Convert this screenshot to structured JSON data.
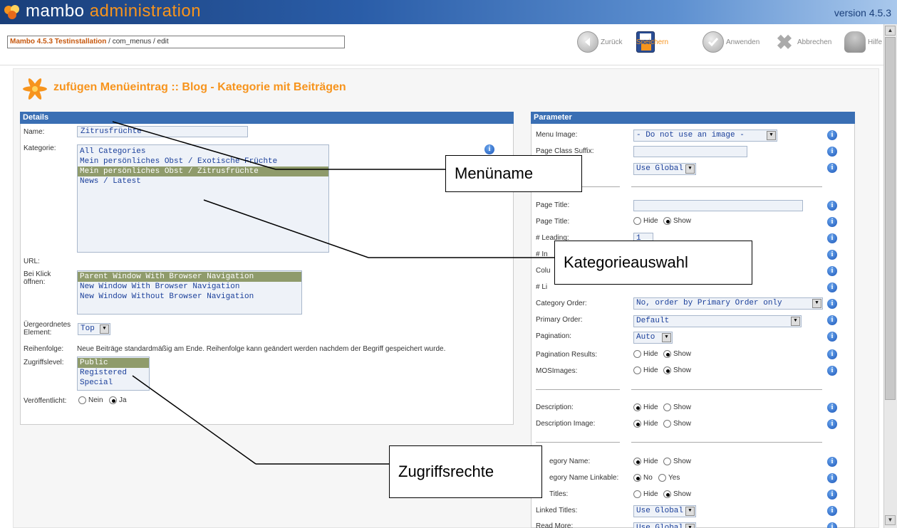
{
  "header": {
    "logo_main": "mambo",
    "logo_accent": "administration",
    "version": "version 4.5.3"
  },
  "toolbar": {
    "site_name": "Mambo 4.5.3 Testinstallation",
    "path": " / com_menus / edit",
    "back": "Zurück",
    "save": "Speichern",
    "apply": "Anwenden",
    "cancel": "Abbrechen",
    "help": "Hilfe"
  },
  "page_title": "zufügen Menüeintrag :: Blog - Kategorie mit Beiträgen",
  "details": {
    "header": "Details",
    "name_label": "Name:",
    "name_value": "Zitrusfrüchte",
    "category_label": "Kategorie:",
    "categories": [
      "All Categories",
      "Mein persönliches Obst / Exotische Früchte",
      "Mein persönliches Obst / Zitrusfrüchte",
      "News / Latest"
    ],
    "selected_category": 2,
    "url_label": "URL:",
    "click_label_1": "Bei Klick",
    "click_label_2": "öffnen:",
    "click_options": [
      "Parent Window With Browser Navigation",
      "New Window With Browser Navigation",
      "New Window Without Browser Navigation"
    ],
    "parent_label_1": "Üergeordnetes",
    "parent_label_2": "Element:",
    "parent_value": "Top",
    "order_label": "Reihenfolge:",
    "order_text": "Neue Beiträge standardmäßig am Ende. Reihenfolge kann geändert werden nachdem der Begriff gespeichert wurde.",
    "access_label": "Zugriffslevel:",
    "access_options": [
      "Public",
      "Registered",
      "Special"
    ],
    "published_label": "Veröffentlicht:",
    "published_no": "Nein",
    "published_yes": "Ja"
  },
  "params": {
    "header": "Parameter",
    "menu_image_label": "Menu Image:",
    "menu_image_value": "- Do not use an image -",
    "page_class_label": "Page Class Suffix:",
    "use_global": "Use Global",
    "page_title_label": "Page Title:",
    "page_title2_label": "Page Title:",
    "hide": "Hide",
    "show": "Show",
    "no": "No",
    "yes": "Yes",
    "leading_label": "# Leading:",
    "leading_value": "1",
    "intro_label": "# In",
    "columns_label": "Colu",
    "links_label": "# Li",
    "category_order_label": "Category Order:",
    "category_order_value": "No, order by Primary Order only",
    "primary_order_label": "Primary Order:",
    "primary_order_value": "Default",
    "pagination_label": "Pagination:",
    "pagination_value": "Auto",
    "pagination_results_label": "Pagination Results:",
    "mosimages_label": "MOSImages:",
    "description_label": "Description:",
    "description_image_label": "Description Image:",
    "category_name_label": "egory Name:",
    "category_name_linkable_label": "egory Name Linkable:",
    "titles_label": "Titles:",
    "linked_titles_label": "Linked Titles:",
    "read_more_label": "Read More:"
  },
  "callouts": {
    "menuname": "Menüname",
    "kategorie": "Kategorieauswahl",
    "zugriff": "Zugriffsrechte"
  },
  "colors": {
    "accent": "#f7941d",
    "panel_header": "#3a6fb4",
    "selected": "#8f9b6b"
  }
}
